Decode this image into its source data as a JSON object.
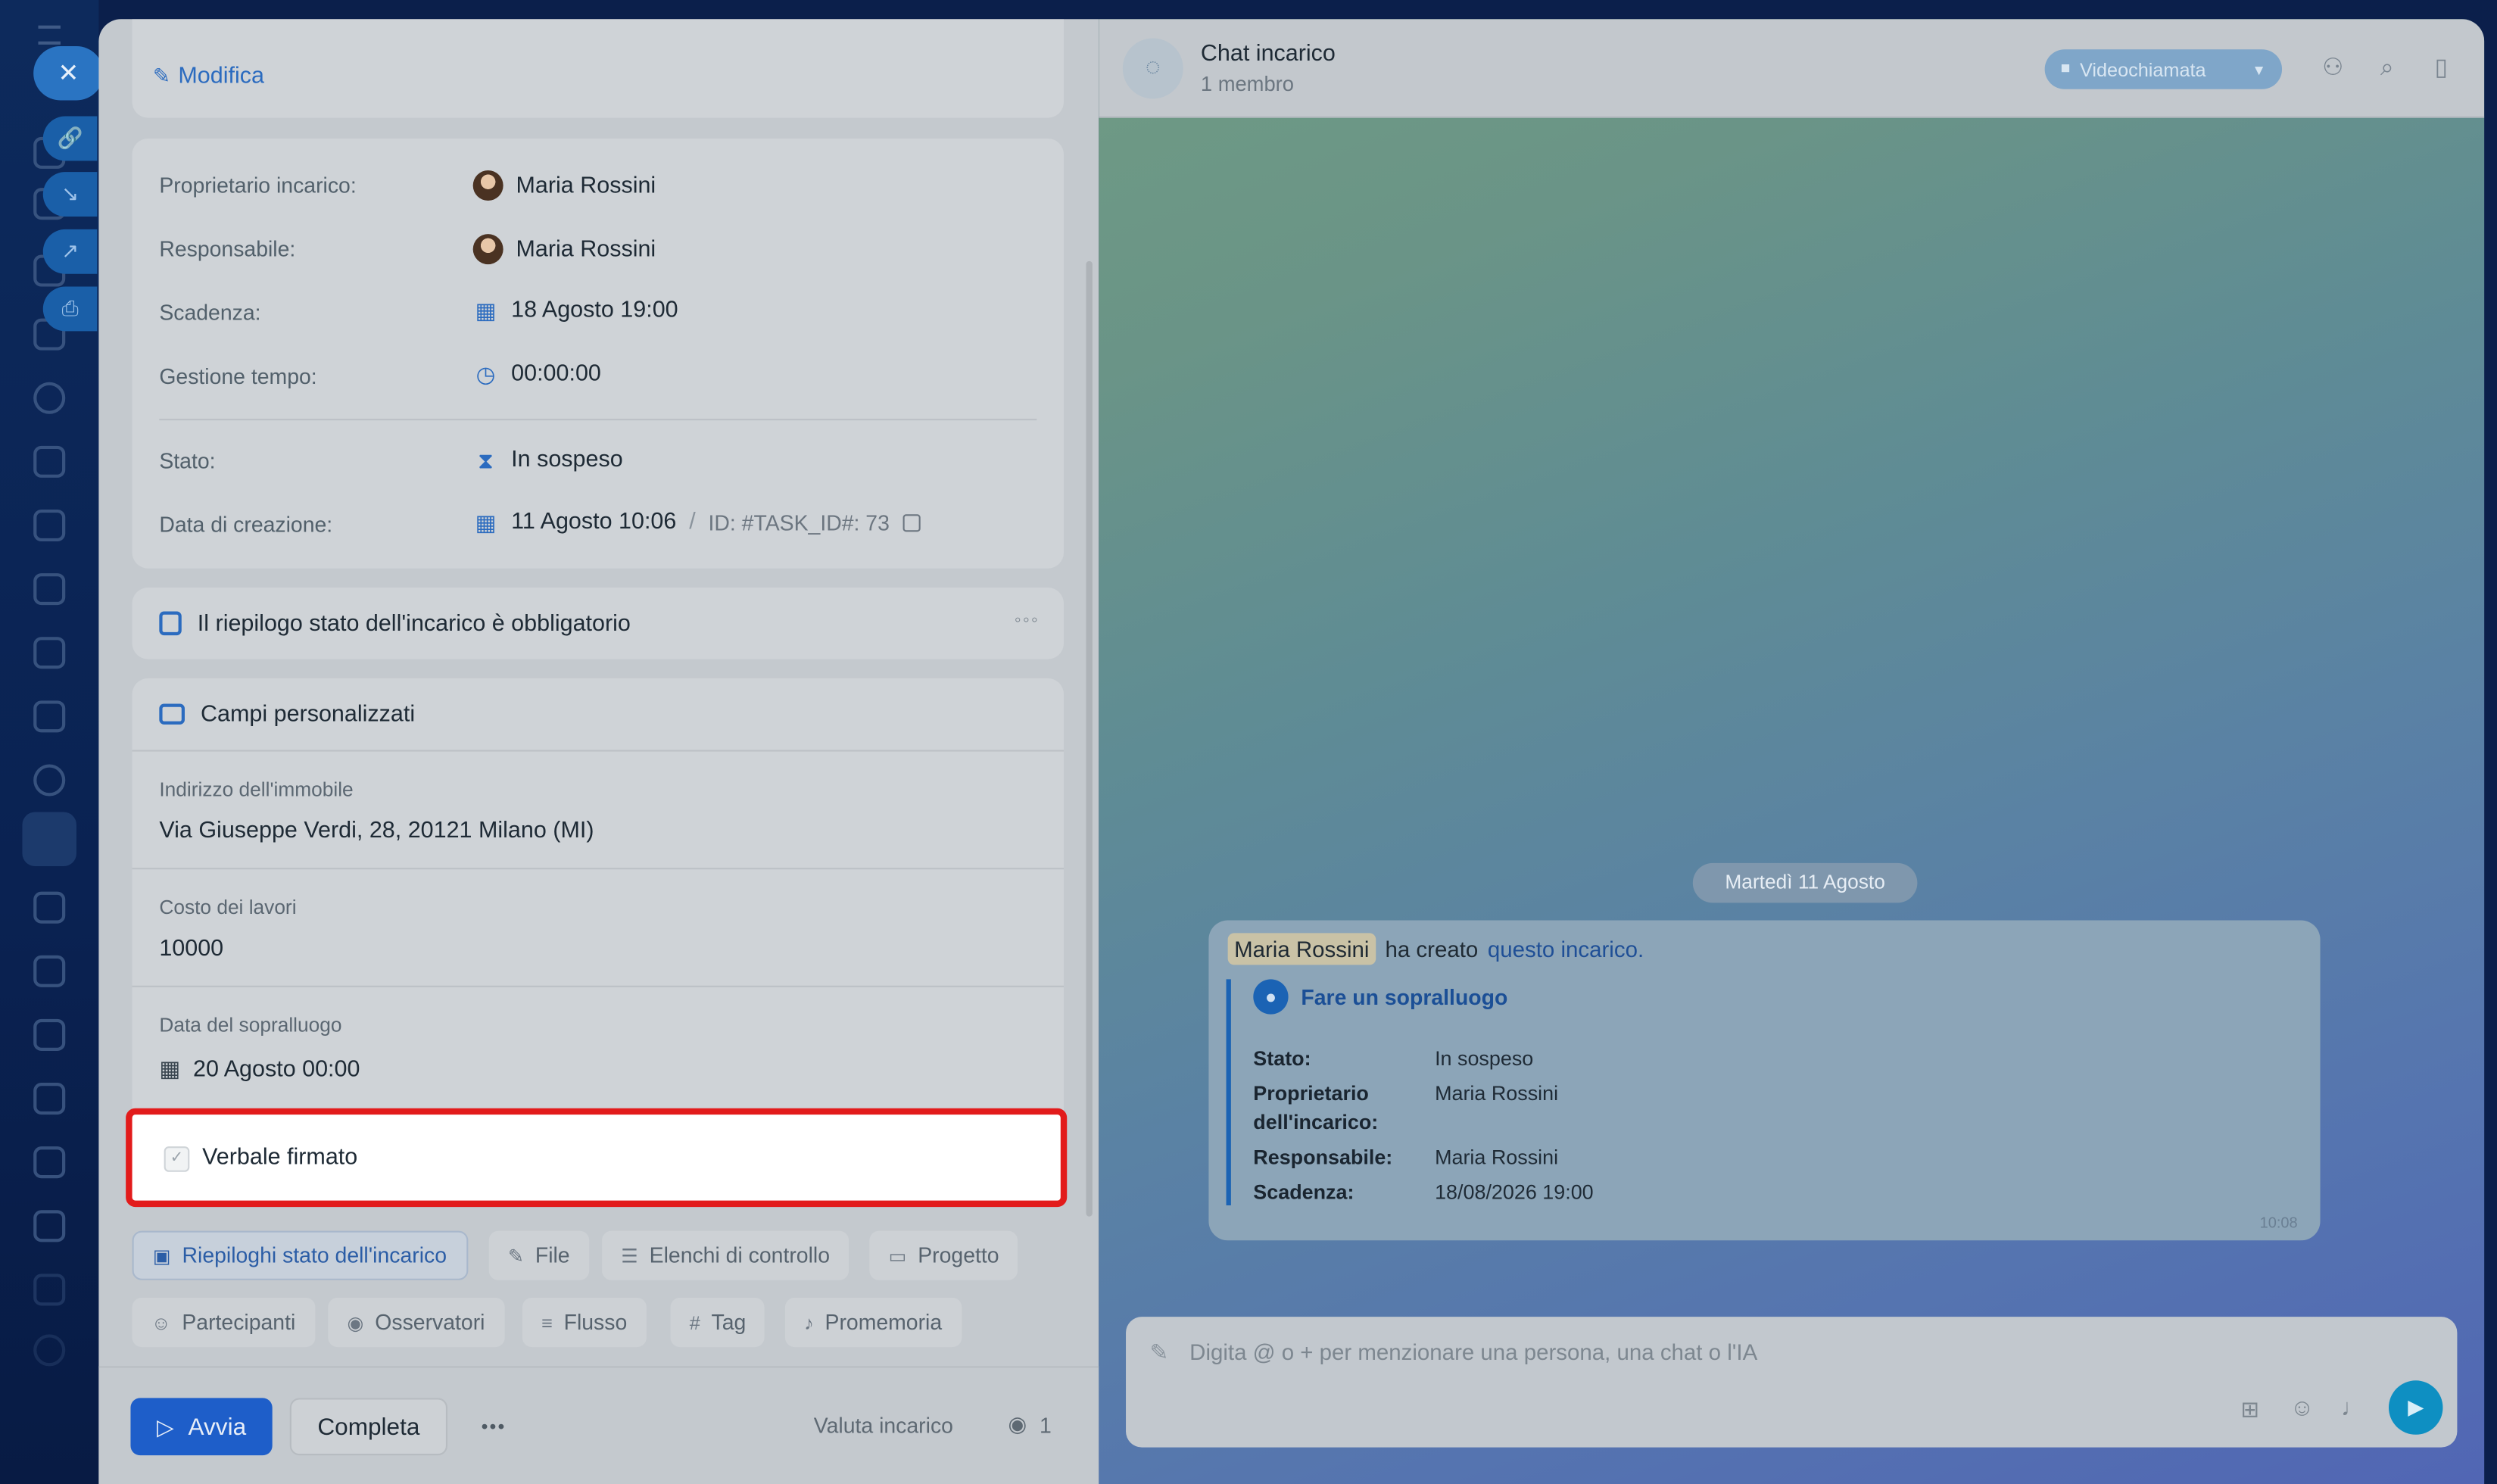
{
  "task": {
    "edit_label": "Modifica",
    "fields": {
      "owner_label": "Proprietario incarico:",
      "owner_value": "Maria Rossini",
      "assignee_label": "Responsabile:",
      "assignee_value": "Maria Rossini",
      "deadline_label": "Scadenza:",
      "deadline_value": "18 Agosto 19:00",
      "time_label": "Gestione tempo:",
      "time_value": "00:00:00",
      "status_label": "Stato:",
      "status_value": "In sospeso",
      "created_label": "Data di creazione:",
      "created_value": "11 Agosto 10:06",
      "id_sep": "/",
      "id_value": "ID: #TASK_ID#: 73"
    },
    "summary_banner": "Il riepilogo stato dell'incarico è obbligatorio",
    "custom_fields": {
      "title": "Campi personalizzati",
      "address_label": "Indirizzo dell'immobile",
      "address_value": "Via Giuseppe Verdi, 28, 20121 Milano (MI)",
      "cost_label": "Costo dei lavori",
      "cost_value": "10000",
      "visit_label": "Data del sopralluogo",
      "visit_value": "20 Agosto 00:00",
      "signed_label": "Verbale firmato",
      "signed_checked": false
    },
    "tabs_row1": [
      "Riepiloghi stato dell'incarico",
      "File",
      "Elenchi di controllo",
      "Progetto"
    ],
    "tabs_row2": [
      "Partecipanti",
      "Osservatori",
      "Flusso",
      "Tag",
      "Promemoria"
    ],
    "footer": {
      "start_label": "Avvia",
      "complete_label": "Completa",
      "more_label": "•••",
      "rate_label": "Valuta incarico",
      "viewers_count": "1"
    }
  },
  "chat": {
    "title": "Chat incarico",
    "subtitle": "1 membro",
    "video_label": "Videochiamata",
    "date_badge": "Martedì 11 Agosto",
    "message": {
      "author": "Maria Rossini",
      "text": "ha creato",
      "link": "questo incarico.",
      "task_title": "Fare un sopralluogo",
      "status_key": "Stato:",
      "status_val": "In sospeso",
      "owner_key_1": "Proprietario",
      "owner_key_2": "dell'incarico:",
      "owner_val": "Maria Rossini",
      "assignee_key": "Responsabile:",
      "assignee_val": "Maria Rossini",
      "deadline_key": "Scadenza:",
      "deadline_val": "18/08/2026 19:00",
      "time": "10:08"
    },
    "composer_placeholder": "Digita @ o + per menzionare una persona, una chat o l'IA"
  },
  "colors": {
    "accent": "#2b6bbf",
    "primary_button": "#1e5ec9",
    "highlight_border": "#e21b1b",
    "send_button": "#0e8fc2"
  }
}
